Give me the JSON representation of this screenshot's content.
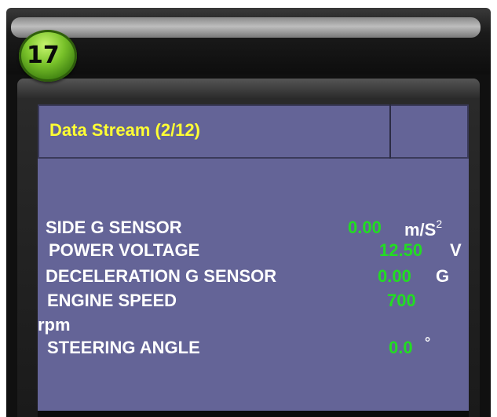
{
  "step": {
    "number": "17"
  },
  "screen": {
    "title": "Data Stream (2/12)",
    "rows": [
      {
        "label": "SIDE G SENSOR",
        "value": "0.00",
        "unit": "m/S",
        "unit_sup": "2"
      },
      {
        "label": "POWER VOLTAGE",
        "value": "12.50",
        "unit": "V"
      },
      {
        "label": "DECELERATION G SENSOR",
        "value": "0.00",
        "unit": "G"
      },
      {
        "label": "ENGINE SPEED",
        "value": "700",
        "unit": "rpm"
      },
      {
        "label": "STEERING ANGLE",
        "value": "0.0",
        "unit": "°"
      }
    ]
  },
  "colors": {
    "screen_bg": "#646497",
    "title_text": "#ffff33",
    "value_text": "#22dd22",
    "label_text": "#ffffff",
    "badge": "#79c22a"
  }
}
